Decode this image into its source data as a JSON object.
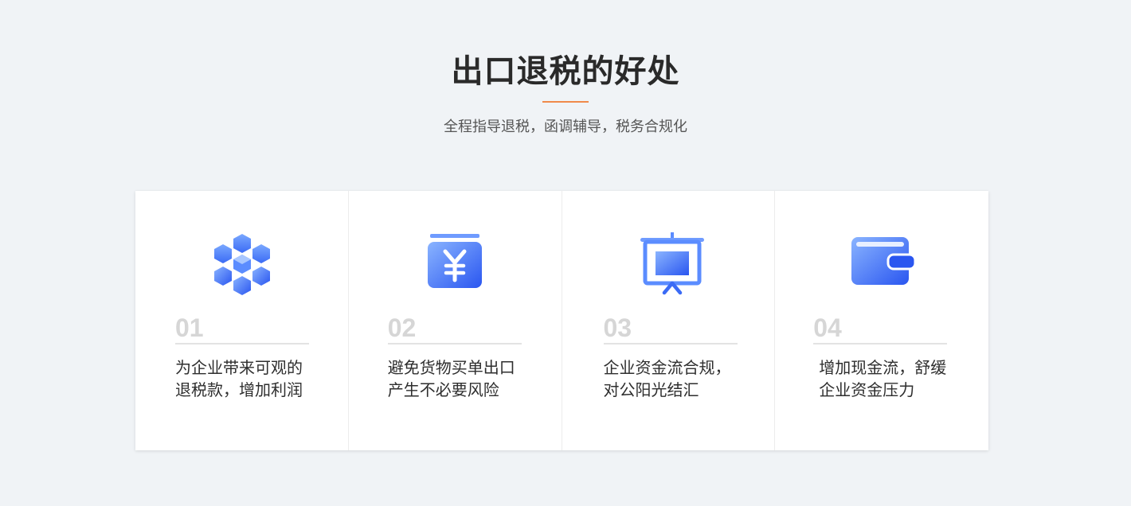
{
  "header": {
    "title": "出口退税的好处",
    "subtitle": "全程指导退税，函调辅导，税务合规化"
  },
  "colors": {
    "accent_line": "#f08a4b",
    "icon_blue_light": "#7aa8ff",
    "icon_blue_dark": "#2a56f0",
    "number_gray": "#d6d6d6"
  },
  "cards": [
    {
      "icon": "blocks-cube-icon",
      "number": "01",
      "line1": "为企业带来可观的",
      "line2": "退税款，增加利润"
    },
    {
      "icon": "yuan-money-icon",
      "number": "02",
      "line1": "避免货物买单出口",
      "line2": "产生不必要风险"
    },
    {
      "icon": "presentation-board-icon",
      "number": "03",
      "line1": "企业资金流合规，",
      "line2": "对公阳光结汇"
    },
    {
      "icon": "wallet-icon",
      "number": "04",
      "line1": "增加现金流，舒缓",
      "line2": "企业资金压力"
    }
  ]
}
